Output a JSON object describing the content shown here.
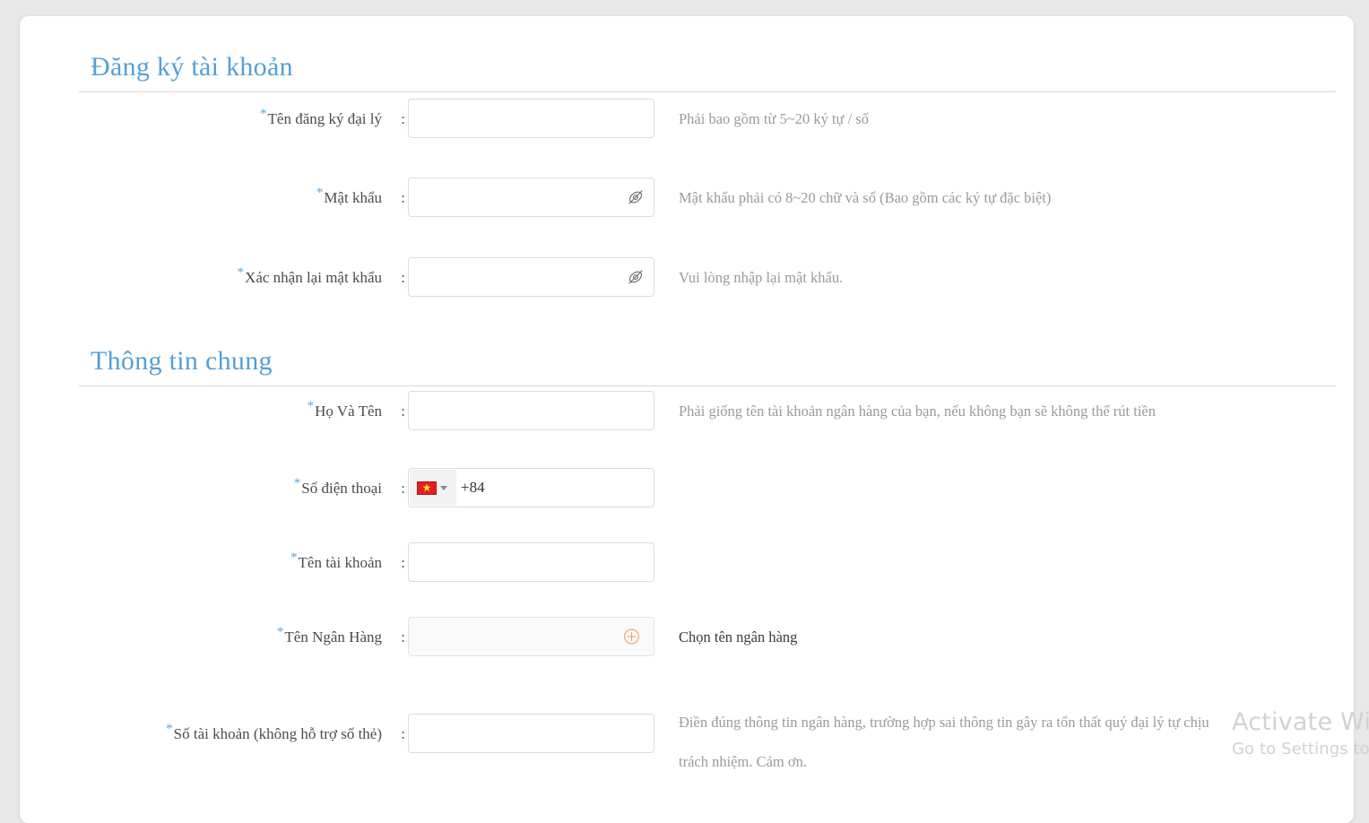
{
  "page": {
    "background_color": "#e8e8e8",
    "card_color": "#ffffff",
    "accent_color": "#54a0d6",
    "required_star": "*",
    "colon": ":"
  },
  "sections": [
    {
      "title": "Đăng ký tài khoản"
    },
    {
      "title": "Thông tin chung"
    }
  ],
  "account_section": {
    "title": "Đăng ký tài khoản",
    "fields": [
      {
        "label": "Tên đăng ký đại lý",
        "value": "",
        "placeholder": "",
        "hint": "Phải bao gồm từ 5~20 ký tự / số",
        "required": true
      },
      {
        "label": "Mật khẩu",
        "value": "",
        "placeholder": "",
        "hint": "Mật khẩu phải có 8~20 chữ và số (Bao gồm các ký tự đặc biệt)",
        "required": true,
        "icon": "eye-slash-icon"
      },
      {
        "label": "Xác nhận lại mật khẩu",
        "value": "",
        "placeholder": "",
        "hint": "Vui lòng nhập lại mật khẩu.",
        "required": true,
        "icon": "eye-slash-icon"
      }
    ]
  },
  "general_section": {
    "title": "Thông tin chung",
    "fields": [
      {
        "label": "Họ Và Tên",
        "value": "",
        "placeholder": "",
        "hint": "Phải giống tên tài khoản ngân hàng của bạn, nếu không bạn sẽ không thể rút tiền",
        "required": true
      },
      {
        "label": "Số điện thoại",
        "value": "+84",
        "placeholder": "",
        "hint": "",
        "required": true,
        "country_flag": "vietnam-flag-icon",
        "dial_code": "+84",
        "icon": "chevron-down-icon"
      },
      {
        "label": "Tên tài khoản",
        "value": "",
        "placeholder": "",
        "hint": "",
        "required": true
      },
      {
        "label": "Tên Ngân Hàng",
        "value": "",
        "placeholder": "",
        "hint": "Chọn tên ngân hàng",
        "hint_style": "dark",
        "required": true,
        "icon": "plus-circle-icon",
        "icon_color": "#e8a86a",
        "readonly": true
      },
      {
        "label": "Số tài khoản (không hỗ trợ số thẻ)",
        "value": "",
        "placeholder": "",
        "hint": "Điền đúng thông tin ngân hàng, trường hợp sai thông tin gây ra tổn thất quý đại lý tự chịu trách nhiệm. Cảm ơn.",
        "hint_wrap": true,
        "required": true
      }
    ]
  },
  "watermark": {
    "title": "Activate Windows",
    "subtitle": "Go to Settings to activate Windows."
  }
}
